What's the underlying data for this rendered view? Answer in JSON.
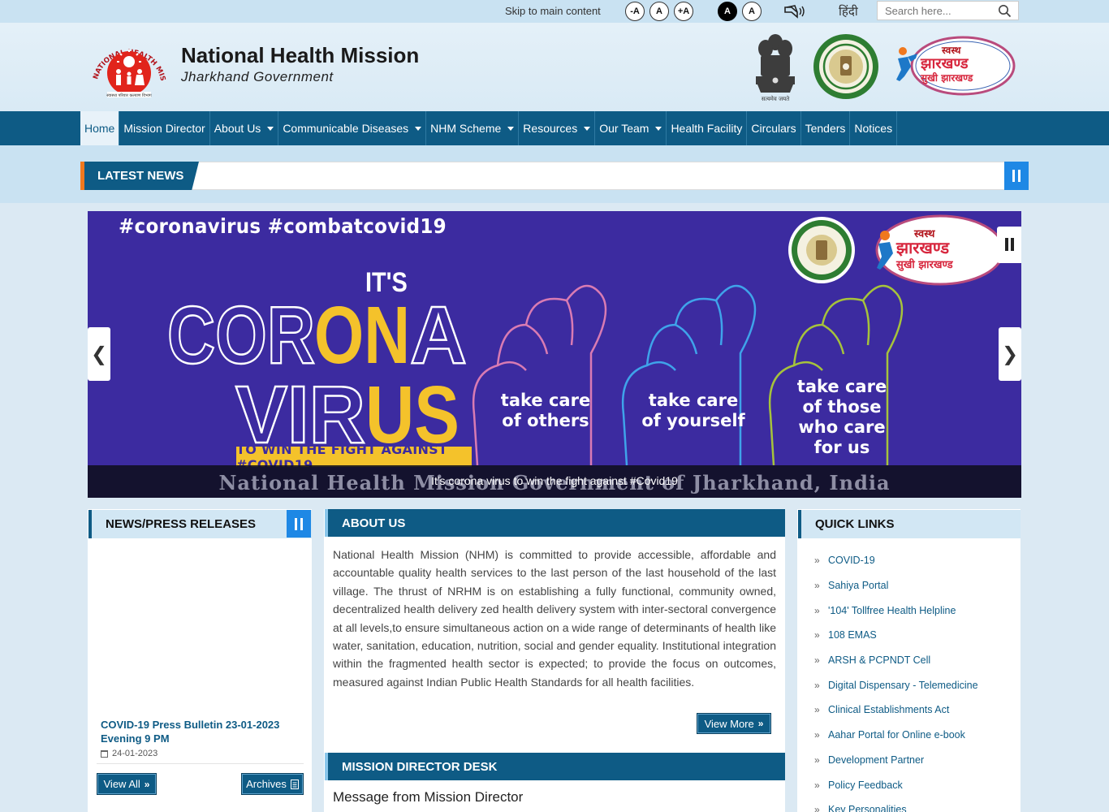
{
  "topbar": {
    "skip_link": "Skip to main content",
    "font_buttons": [
      "-A",
      "A",
      "+A"
    ],
    "contrast_buttons": [
      "A",
      "A"
    ],
    "language_link": "हिंदी",
    "search_placeholder": "Search here..."
  },
  "header": {
    "title": "National Health Mission",
    "subtitle": "Jharkhand Government",
    "logo_text": "NATIONAL HEALTH MISSION",
    "logo_sub": "स्वास्थ्य परिवार कल्याण विभाग",
    "emblem_caption": "सत्यमेव जयते",
    "jh_logo_line1": "स्वस्थ",
    "jh_logo_line2": "झारखण्ड",
    "jh_logo_line3": "सुखी झारखण्ड"
  },
  "nav": {
    "items": [
      {
        "label": "Home",
        "dropdown": false,
        "active": true
      },
      {
        "label": "Mission Director",
        "dropdown": false
      },
      {
        "label": "About Us",
        "dropdown": true
      },
      {
        "label": "Communicable Diseases",
        "dropdown": true
      },
      {
        "label": "NHM Scheme",
        "dropdown": true
      },
      {
        "label": "Resources",
        "dropdown": true
      },
      {
        "label": "Our Team",
        "dropdown": true
      },
      {
        "label": "Health Facility",
        "dropdown": false
      },
      {
        "label": "Circulars",
        "dropdown": false
      },
      {
        "label": "Tenders",
        "dropdown": false
      },
      {
        "label": "Notices",
        "dropdown": false
      }
    ]
  },
  "latest_news": {
    "label": "LATEST NEWS"
  },
  "slider": {
    "hashtags": "#coronavirus #combatcovid19",
    "its": "IT'S",
    "corona_white1": "COR",
    "corona_yellow": "ON",
    "corona_white2": "A",
    "virus_white": "VIR",
    "virus_yellow": "US",
    "win_band": "TO WIN THE FIGHT AGAINST #COVID19",
    "fist_texts": [
      [
        "take care",
        "of others"
      ],
      [
        "take care",
        "of yourself"
      ],
      [
        "take care",
        "of those",
        "who care",
        "for us"
      ]
    ],
    "caption_background": "National Health Mission Government of Jharkhand, India",
    "caption": "It's corona virus to win the fight against #Covid19",
    "colors": {
      "background": "#3c2ba0",
      "accent": "#f4c22b"
    }
  },
  "news_press": {
    "heading": "NEWS/PRESS RELEASES",
    "item_title": "COVID-19 Press Bulletin 23-01-2023 Evening 9 PM",
    "item_date": "24-01-2023",
    "view_all": "View All",
    "archives": "Archives"
  },
  "about": {
    "heading": "ABOUT US",
    "text": "National Health Mission (NHM) is committed to provide accessible, affordable and accountable quality health services to the last person of the last household of the last village. The thrust of NRHM is on establishing a fully functional, community owned, decentralized health delivery zed health delivery system with inter-sectoral convergence at all levels,to ensure simultaneous action on a wide range of determinants of health like water, sanitation, education, nutrition, social and gender equality. Institutional integration within the fragmented health sector is expected; to provide the focus on outcomes, measured against Indian Public Health Standards for all health facilities.",
    "view_more": "View More"
  },
  "md_desk": {
    "heading": "MISSION DIRECTOR DESK",
    "message_title": "Message from Mission Director"
  },
  "quick_links": {
    "heading": "QUICK LINKS",
    "items": [
      "COVID-19",
      "Sahiya Portal",
      "'104' Tollfree Health Helpline",
      "108 EMAS",
      "ARSH & PCPNDT Cell",
      "Digital Dispensary - Telemedicine",
      "Clinical Establishments Act",
      "Aahar Portal for Online e-book",
      "Development Partner",
      "Policy Feedback",
      "Key Personalities"
    ]
  },
  "colors": {
    "primary": "#0e5b85",
    "accent_orange": "#f0781e",
    "button_blue": "#1e88e5"
  }
}
